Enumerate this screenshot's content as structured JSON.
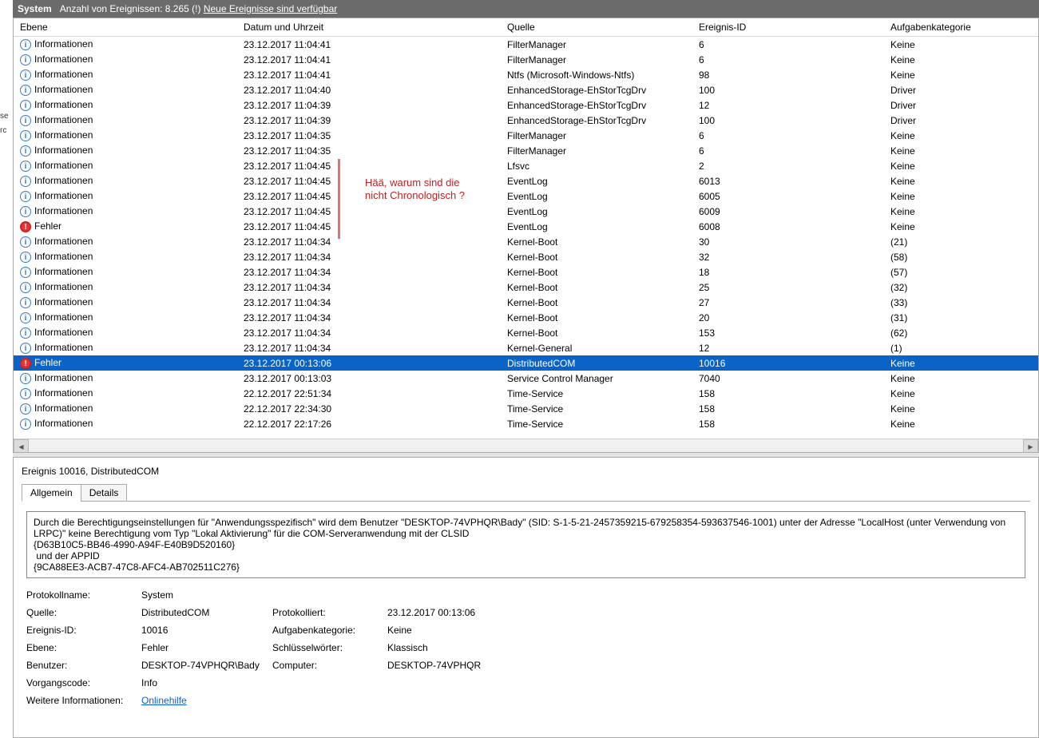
{
  "header": {
    "title": "System",
    "count_label": "Anzahl von Ereignissen:",
    "count_value": "8.265",
    "bang": "(!)",
    "new_events_label": "Neue Ereignisse sind verfügbar"
  },
  "columns": {
    "level": "Ebene",
    "date": "Datum und Uhrzeit",
    "source": "Quelle",
    "eventid": "Ereignis-ID",
    "task": "Aufgabenkategorie"
  },
  "level_labels": {
    "info": "Informationen",
    "error": "Fehler"
  },
  "rows": [
    {
      "level": "info",
      "date": "23.12.2017 11:04:41",
      "source": "FilterManager",
      "eventid": "6",
      "task": "Keine"
    },
    {
      "level": "info",
      "date": "23.12.2017 11:04:41",
      "source": "FilterManager",
      "eventid": "6",
      "task": "Keine"
    },
    {
      "level": "info",
      "date": "23.12.2017 11:04:41",
      "source": "Ntfs (Microsoft-Windows-Ntfs)",
      "eventid": "98",
      "task": "Keine"
    },
    {
      "level": "info",
      "date": "23.12.2017 11:04:40",
      "source": "EnhancedStorage-EhStorTcgDrv",
      "eventid": "100",
      "task": "Driver"
    },
    {
      "level": "info",
      "date": "23.12.2017 11:04:39",
      "source": "EnhancedStorage-EhStorTcgDrv",
      "eventid": "12",
      "task": "Driver"
    },
    {
      "level": "info",
      "date": "23.12.2017 11:04:39",
      "source": "EnhancedStorage-EhStorTcgDrv",
      "eventid": "100",
      "task": "Driver"
    },
    {
      "level": "info",
      "date": "23.12.2017 11:04:35",
      "source": "FilterManager",
      "eventid": "6",
      "task": "Keine"
    },
    {
      "level": "info",
      "date": "23.12.2017 11:04:35",
      "source": "FilterManager",
      "eventid": "6",
      "task": "Keine"
    },
    {
      "level": "info",
      "date": "23.12.2017 11:04:45",
      "source": "Lfsvc",
      "eventid": "2",
      "task": "Keine"
    },
    {
      "level": "info",
      "date": "23.12.2017 11:04:45",
      "source": "EventLog",
      "eventid": "6013",
      "task": "Keine"
    },
    {
      "level": "info",
      "date": "23.12.2017 11:04:45",
      "source": "EventLog",
      "eventid": "6005",
      "task": "Keine"
    },
    {
      "level": "info",
      "date": "23.12.2017 11:04:45",
      "source": "EventLog",
      "eventid": "6009",
      "task": "Keine"
    },
    {
      "level": "error",
      "date": "23.12.2017 11:04:45",
      "source": "EventLog",
      "eventid": "6008",
      "task": "Keine"
    },
    {
      "level": "info",
      "date": "23.12.2017 11:04:34",
      "source": "Kernel-Boot",
      "eventid": "30",
      "task": "(21)"
    },
    {
      "level": "info",
      "date": "23.12.2017 11:04:34",
      "source": "Kernel-Boot",
      "eventid": "32",
      "task": "(58)"
    },
    {
      "level": "info",
      "date": "23.12.2017 11:04:34",
      "source": "Kernel-Boot",
      "eventid": "18",
      "task": "(57)"
    },
    {
      "level": "info",
      "date": "23.12.2017 11:04:34",
      "source": "Kernel-Boot",
      "eventid": "25",
      "task": "(32)"
    },
    {
      "level": "info",
      "date": "23.12.2017 11:04:34",
      "source": "Kernel-Boot",
      "eventid": "27",
      "task": "(33)"
    },
    {
      "level": "info",
      "date": "23.12.2017 11:04:34",
      "source": "Kernel-Boot",
      "eventid": "20",
      "task": "(31)"
    },
    {
      "level": "info",
      "date": "23.12.2017 11:04:34",
      "source": "Kernel-Boot",
      "eventid": "153",
      "task": "(62)"
    },
    {
      "level": "info",
      "date": "23.12.2017 11:04:34",
      "source": "Kernel-General",
      "eventid": "12",
      "task": "(1)"
    },
    {
      "level": "error",
      "date": "23.12.2017 00:13:06",
      "source": "DistributedCOM",
      "eventid": "10016",
      "task": "Keine",
      "selected": true
    },
    {
      "level": "info",
      "date": "23.12.2017 00:13:03",
      "source": "Service Control Manager",
      "eventid": "7040",
      "task": "Keine"
    },
    {
      "level": "info",
      "date": "22.12.2017 22:51:34",
      "source": "Time-Service",
      "eventid": "158",
      "task": "Keine"
    },
    {
      "level": "info",
      "date": "22.12.2017 22:34:30",
      "source": "Time-Service",
      "eventid": "158",
      "task": "Keine"
    },
    {
      "level": "info",
      "date": "22.12.2017 22:17:26",
      "source": "Time-Service",
      "eventid": "158",
      "task": "Keine"
    }
  ],
  "annotation": {
    "text": "Hää, warum sind die\nnicht Chronologisch ?"
  },
  "detail": {
    "title": "Ereignis 10016, DistributedCOM",
    "tabs": {
      "general": "Allgemein",
      "details": "Details"
    },
    "description": "Durch die Berechtigungseinstellungen für \"Anwendungsspezifisch\" wird dem Benutzer \"DESKTOP-74VPHQR\\Bady\" (SID: S-1-5-21-2457359215-679258354-593637546-1001) unter der Adresse \"LocalHost (unter Verwendung von LRPC)\" keine Berechtigung vom Typ \"Lokal Aktivierung\" für die COM-Serveranwendung mit der CLSID\n{D63B10C5-BB46-4990-A94F-E40B9D520160}\n und der APPID\n{9CA88EE3-ACB7-47C8-AFC4-AB702511C276}",
    "fields": {
      "logname_label": "Protokollname:",
      "logname_value": "System",
      "source_label": "Quelle:",
      "source_value": "DistributedCOM",
      "logged_label": "Protokolliert:",
      "logged_value": "23.12.2017 00:13:06",
      "eventid_label": "Ereignis-ID:",
      "eventid_value": "10016",
      "taskcat_label": "Aufgabenkategorie:",
      "taskcat_value": "Keine",
      "level_label": "Ebene:",
      "level_value": "Fehler",
      "keywords_label": "Schlüsselwörter:",
      "keywords_value": "Klassisch",
      "user_label": "Benutzer:",
      "user_value": "DESKTOP-74VPHQR\\Bady",
      "computer_label": "Computer:",
      "computer_value": "DESKTOP-74VPHQR",
      "opcode_label": "Vorgangscode:",
      "opcode_value": "Info",
      "moreinfo_label": "Weitere Informationen:",
      "moreinfo_link": "Onlinehilfe"
    }
  },
  "leftstrip": {
    "a": "se",
    "b": "rc"
  }
}
